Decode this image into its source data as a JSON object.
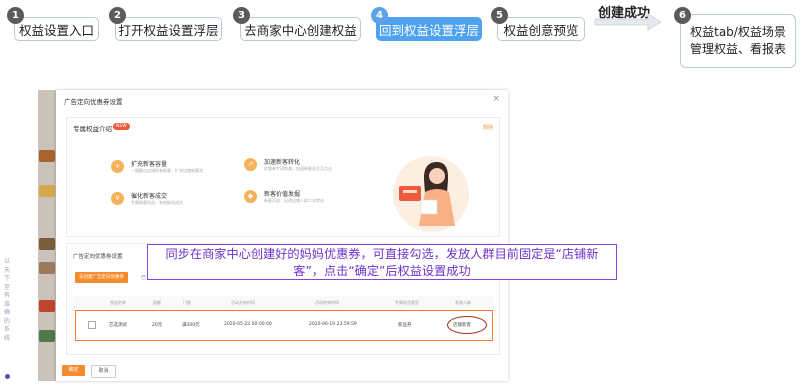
{
  "steps": [
    {
      "number": "1",
      "label": "权益设置入口"
    },
    {
      "number": "2",
      "label": "打开权益设置浮层"
    },
    {
      "number": "3",
      "label": "去商家中心创建权益"
    },
    {
      "number": "4",
      "label": "回到权益设置浮层",
      "active": true
    },
    {
      "number": "5",
      "label": "权益创意预览"
    },
    {
      "number": "6",
      "label": "权益tab/权益场景管理权益、看报表"
    }
  ],
  "success_label": "创建成功",
  "modal": {
    "title": "广告定向优惠券设置",
    "close_glyph": "×",
    "exclusive_section": {
      "title": "专属权益介绍",
      "badge": "NEW",
      "rule_link": "规则",
      "benefits": [
        {
          "icon": "user-plus-icon",
          "title": "扩充新客容量",
          "desc": "一键触达店铺所有新客，扩充店铺新客池"
        },
        {
          "icon": "trend-icon",
          "title": "加速新客转化",
          "desc": "优惠券专项刺激，加速新客关注至点击"
        },
        {
          "icon": "cart-icon",
          "title": "催化新客成交",
          "desc": "专属新客权益，有效催化成交"
        },
        {
          "icon": "gift-icon",
          "title": "新客价值发掘",
          "desc": "新客沉淀，促进店铺人群二次转化"
        }
      ]
    },
    "coupon_section": {
      "title": "广告定向优惠券设置",
      "create_button": "去创建广告定向优惠券",
      "history_tab": "已",
      "columns": [
        "权益名称",
        "面额",
        "门槛",
        "活动开始时间",
        "活动结束时间",
        "专属权益类型",
        "发放人群"
      ],
      "row": {
        "name": "芯选测试",
        "amount": "20元",
        "threshold": "满300元",
        "start": "2020-05-23 00:00:00",
        "end": "2020-06-19 23:59:59",
        "type": "新品券",
        "audience": "店铺新客"
      }
    },
    "ok_button": "确定",
    "cancel_button": "取消"
  },
  "annotation": "同步在商家中心创建好的妈妈优惠券，可直接勾选，发放人群目前固定是“店铺新客”，点击“确定”后权益设置成功",
  "background": {
    "side_text": "以天下至有准确的系统",
    "colors": {
      "accent": "#f58a2e",
      "step_active": "#4fa3ee",
      "annotation": "#8a45d8"
    }
  }
}
